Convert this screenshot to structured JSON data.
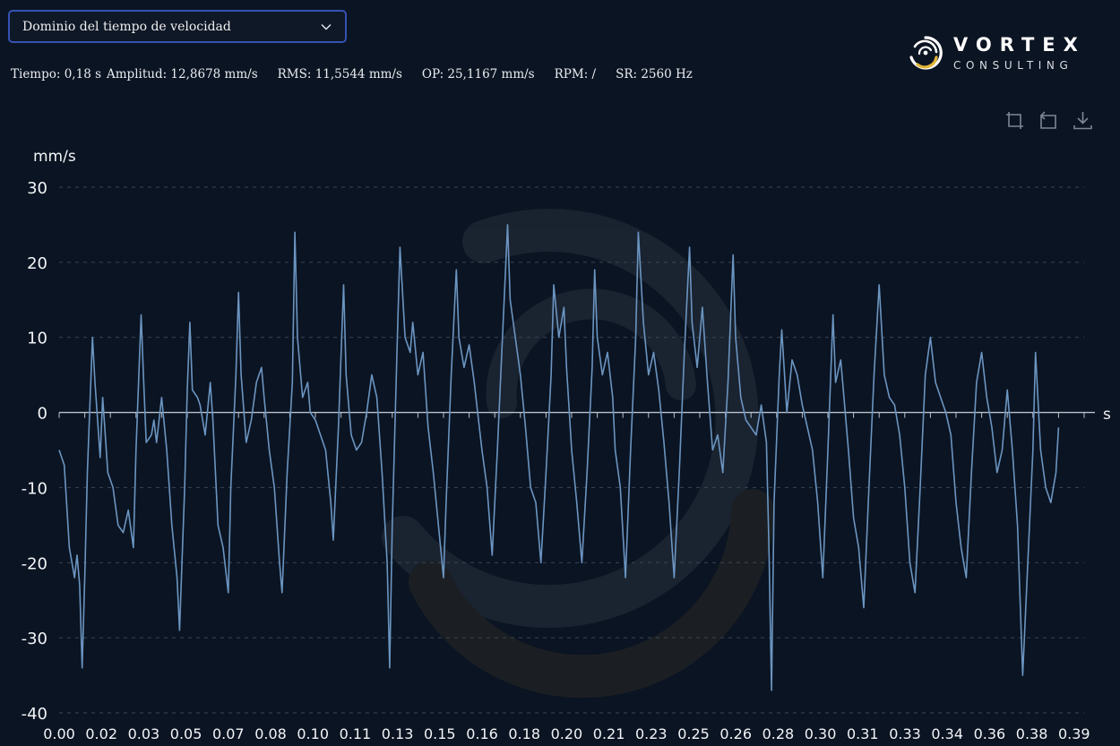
{
  "selector": {
    "value": "Dominio del tiempo de velocidad",
    "icon": "chevron-down-icon"
  },
  "stats": {
    "time": "Tiempo: 0,18 s",
    "amplitude": "Amplitud: 12,8678 mm/s",
    "rms": "RMS: 11,5544 mm/s",
    "op": "OP: 25,1167 mm/s",
    "rpm": "RPM: /",
    "sr": "SR: 2560 Hz"
  },
  "logo": {
    "title": "VORTEX",
    "subtitle": "CONSULTING",
    "icon": "vortex-swirl-logo-icon",
    "colors": {
      "white": "#ffffff",
      "gold": "#e3b53a"
    }
  },
  "toolbar": {
    "icons": [
      "zoom-select-icon",
      "zoom-reset-icon",
      "download-icon"
    ]
  },
  "colors": {
    "background": "#0b1422",
    "line": "#6b95c1",
    "grid": "#3b4656",
    "zero_line": "#b9c2cd",
    "accent_border": "#3552b3"
  },
  "chart_data": {
    "type": "line",
    "title": "",
    "xlabel": "s",
    "ylabel": "mm/s",
    "ylim": [
      -40,
      30
    ],
    "xlim": [
      0,
      0.4
    ],
    "grid": true,
    "y_ticks": [
      "30",
      "20",
      "10",
      "0",
      "-10",
      "-20",
      "-30",
      "-40"
    ],
    "x_ticks": [
      "0.00",
      "0.02",
      "0.03",
      "0.05",
      "0.07",
      "0.08",
      "0.10",
      "0.11",
      "0.13",
      "0.15",
      "0.16",
      "0.18",
      "0.20",
      "0.21",
      "0.23",
      "0.25",
      "0.26",
      "0.28",
      "0.30",
      "0.31",
      "0.33",
      "0.34",
      "0.36",
      "0.38",
      "0.39"
    ],
    "series": [
      {
        "name": "",
        "color": "#6b95c1",
        "points": [
          [
            0.0,
            -5
          ],
          [
            0.002,
            -7
          ],
          [
            0.004,
            -18
          ],
          [
            0.006,
            -22
          ],
          [
            0.007,
            -19
          ],
          [
            0.008,
            -23
          ],
          [
            0.009,
            -34
          ],
          [
            0.01,
            -22
          ],
          [
            0.011,
            -8
          ],
          [
            0.013,
            10
          ],
          [
            0.014,
            4
          ],
          [
            0.016,
            -6
          ],
          [
            0.017,
            2
          ],
          [
            0.018,
            -3
          ],
          [
            0.019,
            -8
          ],
          [
            0.021,
            -10
          ],
          [
            0.023,
            -15
          ],
          [
            0.025,
            -16
          ],
          [
            0.027,
            -13
          ],
          [
            0.029,
            -18
          ],
          [
            0.03,
            -5
          ],
          [
            0.032,
            13
          ],
          [
            0.033,
            4
          ],
          [
            0.034,
            -4
          ],
          [
            0.036,
            -3
          ],
          [
            0.037,
            -1
          ],
          [
            0.038,
            -4
          ],
          [
            0.04,
            2
          ],
          [
            0.042,
            -5
          ],
          [
            0.044,
            -15
          ],
          [
            0.046,
            -22
          ],
          [
            0.047,
            -29
          ],
          [
            0.049,
            -10
          ],
          [
            0.05,
            3
          ],
          [
            0.051,
            12
          ],
          [
            0.052,
            3
          ],
          [
            0.054,
            2
          ],
          [
            0.055,
            1
          ],
          [
            0.057,
            -3
          ],
          [
            0.059,
            4
          ],
          [
            0.06,
            -1
          ],
          [
            0.062,
            -15
          ],
          [
            0.064,
            -18
          ],
          [
            0.066,
            -24
          ],
          [
            0.067,
            -10
          ],
          [
            0.069,
            5
          ],
          [
            0.07,
            16
          ],
          [
            0.071,
            5
          ],
          [
            0.073,
            -4
          ],
          [
            0.075,
            -1
          ],
          [
            0.077,
            4
          ],
          [
            0.079,
            6
          ],
          [
            0.08,
            2
          ],
          [
            0.082,
            -5
          ],
          [
            0.084,
            -10
          ],
          [
            0.086,
            -20
          ],
          [
            0.087,
            -24
          ],
          [
            0.089,
            -8
          ],
          [
            0.091,
            4
          ],
          [
            0.092,
            24
          ],
          [
            0.093,
            10
          ],
          [
            0.095,
            2
          ],
          [
            0.097,
            4
          ],
          [
            0.098,
            0
          ],
          [
            0.1,
            -1
          ],
          [
            0.102,
            -3
          ],
          [
            0.104,
            -5
          ],
          [
            0.106,
            -12
          ],
          [
            0.107,
            -17
          ],
          [
            0.109,
            -2
          ],
          [
            0.111,
            17
          ],
          [
            0.112,
            5
          ],
          [
            0.114,
            -3
          ],
          [
            0.116,
            -5
          ],
          [
            0.118,
            -4
          ],
          [
            0.12,
            0
          ],
          [
            0.122,
            5
          ],
          [
            0.124,
            2
          ],
          [
            0.126,
            -8
          ],
          [
            0.128,
            -20
          ],
          [
            0.129,
            -34
          ],
          [
            0.13,
            -15
          ],
          [
            0.132,
            10
          ],
          [
            0.133,
            22
          ],
          [
            0.135,
            10
          ],
          [
            0.137,
            8
          ],
          [
            0.138,
            12
          ],
          [
            0.14,
            5
          ],
          [
            0.142,
            8
          ],
          [
            0.144,
            -2
          ],
          [
            0.146,
            -8
          ],
          [
            0.148,
            -15
          ],
          [
            0.15,
            -22
          ],
          [
            0.151,
            -12
          ],
          [
            0.153,
            5
          ],
          [
            0.155,
            19
          ],
          [
            0.156,
            10
          ],
          [
            0.158,
            6
          ],
          [
            0.16,
            9
          ],
          [
            0.162,
            4
          ],
          [
            0.164,
            -2
          ],
          [
            0.165,
            -5
          ],
          [
            0.167,
            -10
          ],
          [
            0.169,
            -19
          ],
          [
            0.171,
            -5
          ],
          [
            0.173,
            10
          ],
          [
            0.175,
            25
          ],
          [
            0.176,
            15
          ],
          [
            0.178,
            10
          ],
          [
            0.18,
            5
          ],
          [
            0.182,
            -2
          ],
          [
            0.184,
            -10
          ],
          [
            0.186,
            -12
          ],
          [
            0.188,
            -20
          ],
          [
            0.19,
            -8
          ],
          [
            0.192,
            5
          ],
          [
            0.193,
            17
          ],
          [
            0.195,
            10
          ],
          [
            0.197,
            14
          ],
          [
            0.198,
            6
          ],
          [
            0.2,
            -5
          ],
          [
            0.202,
            -12
          ],
          [
            0.204,
            -20
          ],
          [
            0.206,
            -8
          ],
          [
            0.208,
            6
          ],
          [
            0.209,
            19
          ],
          [
            0.21,
            10
          ],
          [
            0.212,
            5
          ],
          [
            0.214,
            8
          ],
          [
            0.216,
            2
          ],
          [
            0.217,
            -5
          ],
          [
            0.219,
            -10
          ],
          [
            0.221,
            -22
          ],
          [
            0.223,
            -5
          ],
          [
            0.225,
            10
          ],
          [
            0.226,
            24
          ],
          [
            0.228,
            12
          ],
          [
            0.23,
            5
          ],
          [
            0.232,
            8
          ],
          [
            0.234,
            3
          ],
          [
            0.236,
            -4
          ],
          [
            0.238,
            -12
          ],
          [
            0.24,
            -22
          ],
          [
            0.242,
            -8
          ],
          [
            0.244,
            8
          ],
          [
            0.246,
            22
          ],
          [
            0.247,
            12
          ],
          [
            0.249,
            6
          ],
          [
            0.251,
            14
          ],
          [
            0.253,
            4
          ],
          [
            0.255,
            -5
          ],
          [
            0.257,
            -3
          ],
          [
            0.259,
            -8
          ],
          [
            0.261,
            4
          ],
          [
            0.263,
            21
          ],
          [
            0.264,
            10
          ],
          [
            0.266,
            2
          ],
          [
            0.268,
            -1
          ],
          [
            0.27,
            -2
          ],
          [
            0.272,
            -3
          ],
          [
            0.274,
            1
          ],
          [
            0.276,
            -4
          ],
          [
            0.277,
            -18
          ],
          [
            0.278,
            -37
          ],
          [
            0.279,
            -12
          ],
          [
            0.281,
            5
          ],
          [
            0.282,
            11
          ],
          [
            0.284,
            0
          ],
          [
            0.286,
            7
          ],
          [
            0.288,
            5
          ],
          [
            0.29,
            1
          ],
          [
            0.292,
            -2
          ],
          [
            0.294,
            -5
          ],
          [
            0.296,
            -12
          ],
          [
            0.298,
            -22
          ],
          [
            0.3,
            -5
          ],
          [
            0.302,
            13
          ],
          [
            0.303,
            4
          ],
          [
            0.305,
            7
          ],
          [
            0.306,
            3
          ],
          [
            0.308,
            -5
          ],
          [
            0.31,
            -14
          ],
          [
            0.312,
            -18
          ],
          [
            0.314,
            -26
          ],
          [
            0.316,
            -10
          ],
          [
            0.318,
            5
          ],
          [
            0.32,
            17
          ],
          [
            0.322,
            5
          ],
          [
            0.324,
            2
          ],
          [
            0.326,
            1
          ],
          [
            0.328,
            -3
          ],
          [
            0.33,
            -10
          ],
          [
            0.332,
            -20
          ],
          [
            0.334,
            -24
          ],
          [
            0.336,
            -10
          ],
          [
            0.338,
            5
          ],
          [
            0.34,
            10
          ],
          [
            0.342,
            4
          ],
          [
            0.344,
            2
          ],
          [
            0.346,
            0
          ],
          [
            0.348,
            -3
          ],
          [
            0.35,
            -12
          ],
          [
            0.352,
            -18
          ],
          [
            0.354,
            -22
          ],
          [
            0.356,
            -8
          ],
          [
            0.358,
            4
          ],
          [
            0.36,
            8
          ],
          [
            0.362,
            2
          ],
          [
            0.364,
            -2
          ],
          [
            0.366,
            -8
          ],
          [
            0.368,
            -5
          ],
          [
            0.37,
            3
          ],
          [
            0.372,
            -5
          ],
          [
            0.374,
            -15
          ],
          [
            0.375,
            -25
          ],
          [
            0.376,
            -35
          ],
          [
            0.378,
            -20
          ],
          [
            0.38,
            -5
          ],
          [
            0.381,
            8
          ],
          [
            0.383,
            -5
          ],
          [
            0.385,
            -10
          ],
          [
            0.387,
            -12
          ],
          [
            0.389,
            -8
          ],
          [
            0.39,
            -2
          ]
        ]
      }
    ]
  }
}
